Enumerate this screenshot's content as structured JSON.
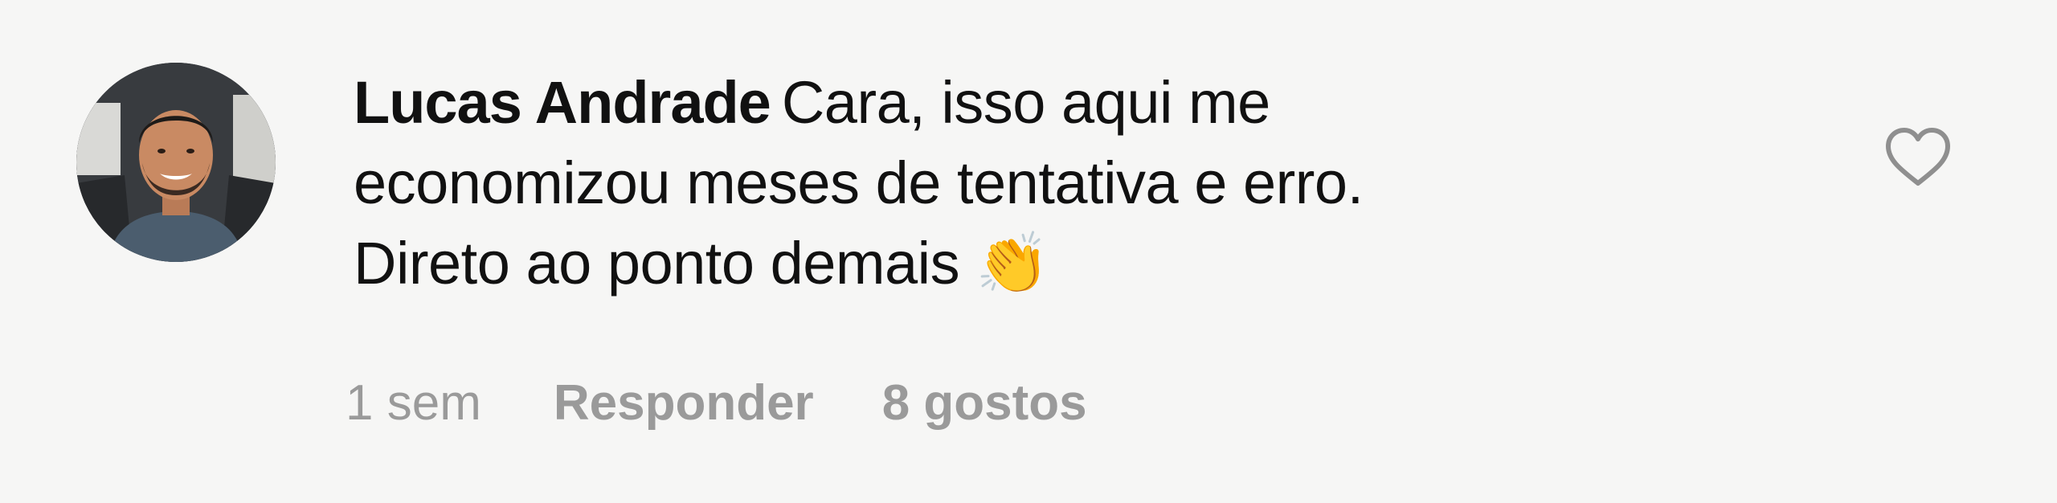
{
  "comment": {
    "author": "Lucas Andrade",
    "text_line_1": "Cara, isso aqui me",
    "text_line_2": "economizou meses de tentativa e erro.",
    "text_line_3": "Direto ao ponto demais",
    "emoji": "👏",
    "timestamp": "1 sem",
    "reply_label": "Responder",
    "likes_label": "8 gostos"
  },
  "icons": {
    "avatar": "user-avatar-photo",
    "like": "heart-outline-icon"
  },
  "colors": {
    "background": "#f6f6f5",
    "text": "#111111",
    "meta_text": "#9a9a9a",
    "emoji": "#f5c02a"
  }
}
